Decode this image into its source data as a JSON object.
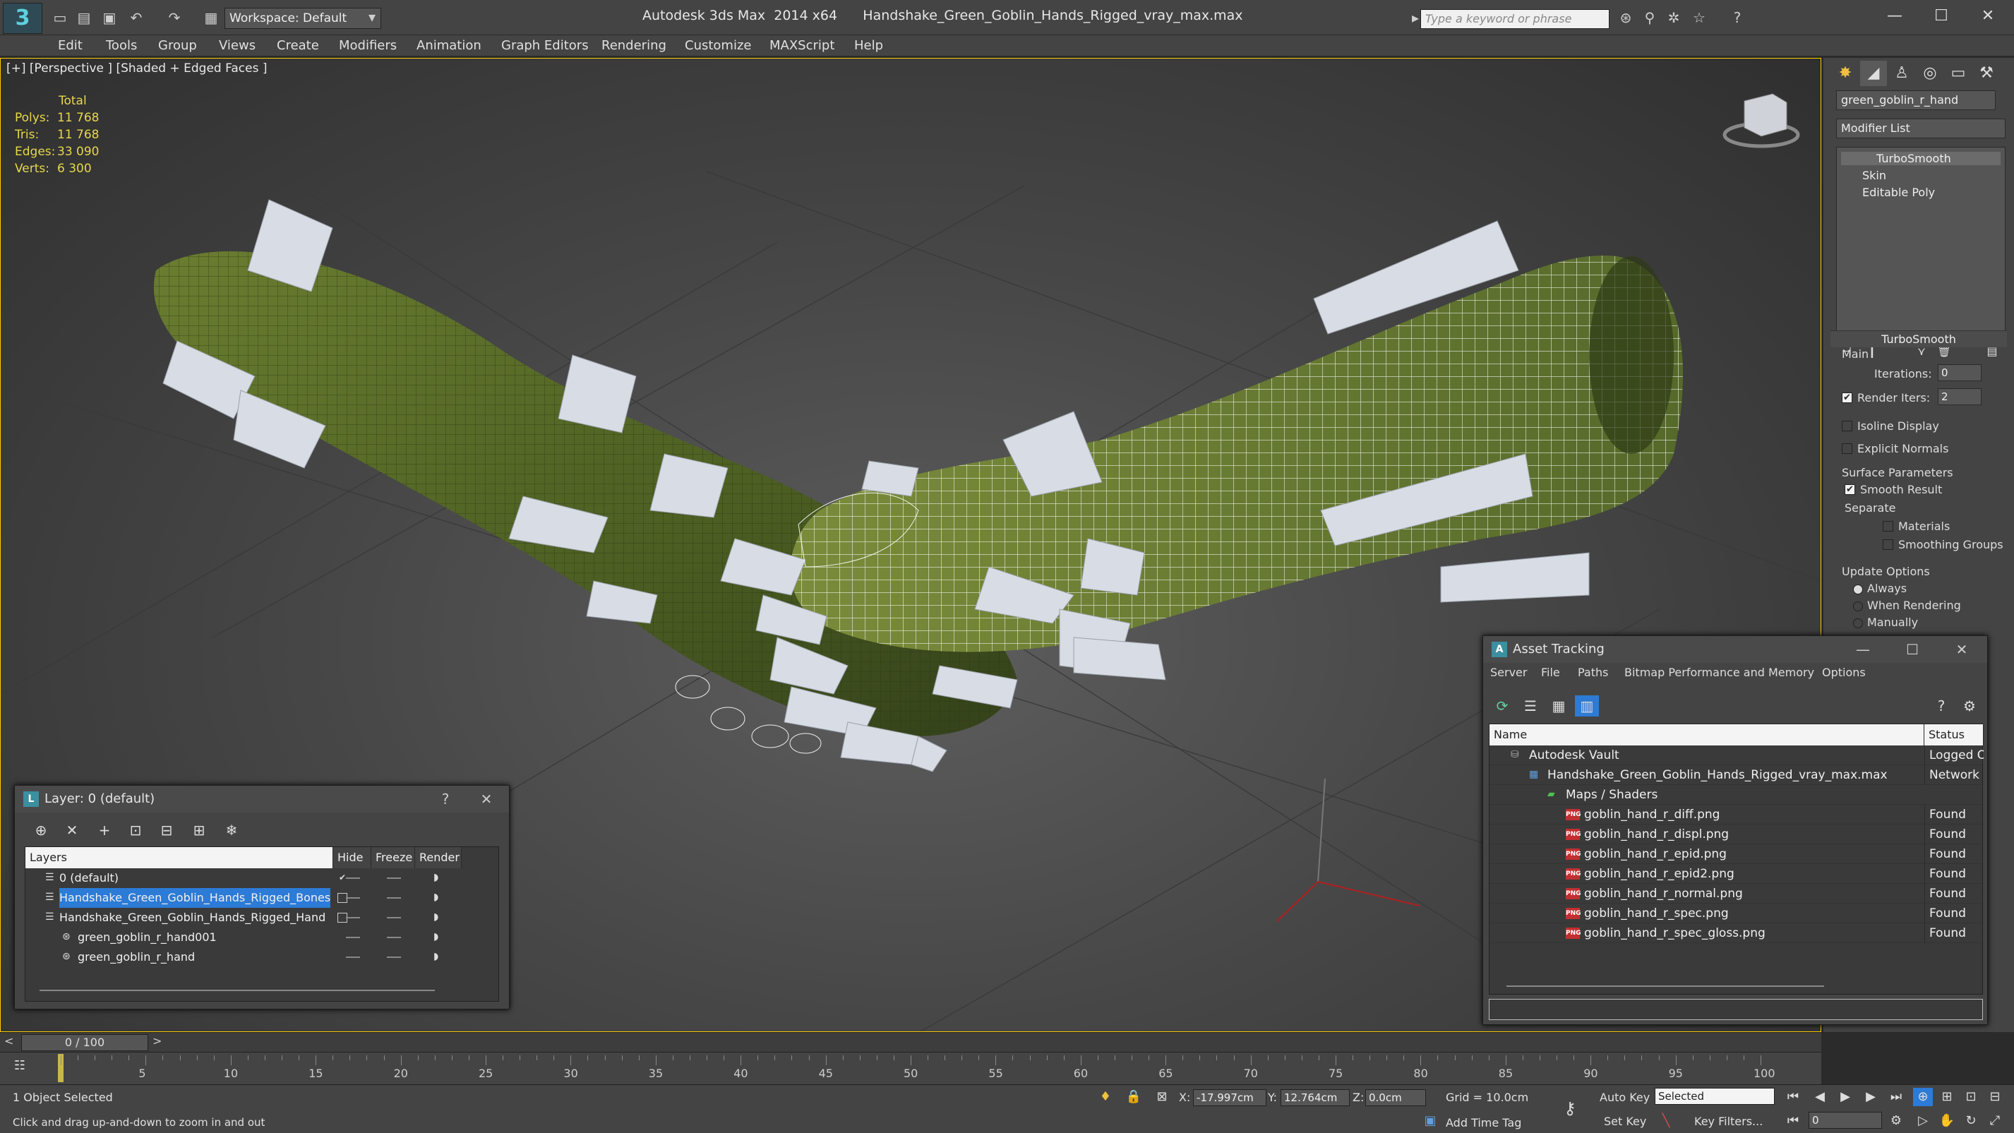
{
  "window": {
    "app_title": "Autodesk 3ds Max  2014 x64      Handshake_Green_Goblin_Hands_Rigged_vray_max.max",
    "workspace": "Workspace: Default",
    "search_placeholder": "Type a keyword or phrase"
  },
  "menu": [
    "Edit",
    "Tools",
    "Group",
    "Views",
    "Create",
    "Modifiers",
    "Animation",
    "Graph Editors",
    "Rendering",
    "Customize",
    "MAXScript",
    "Help"
  ],
  "viewport": {
    "label": "[+] [Perspective ] [Shaded + Edged Faces ]",
    "stats": {
      "header": "Total",
      "rows": [
        {
          "k": "Polys:",
          "v": "11 768"
        },
        {
          "k": "Tris:",
          "v": "11 768"
        },
        {
          "k": "Edges:",
          "v": "33 090"
        },
        {
          "k": "Verts:",
          "v": "6 300"
        }
      ]
    },
    "colors": {
      "skin": "#5a6e2a",
      "skin_dark": "#3e4e1c",
      "bones": "#d8dce4",
      "wire": "#ffffff"
    }
  },
  "command_panel": {
    "object_name": "green_goblin_r_hand",
    "modifier_list": "Modifier List",
    "stack": [
      "TurboSmooth",
      "Skin",
      "Editable Poly"
    ],
    "rollout": "TurboSmooth",
    "main_label": "Main",
    "iterations_label": "Iterations:",
    "iterations_value": "0",
    "render_iters_label": "Render Iters:",
    "render_iters_value": "2",
    "isoline_label": "Isoline Display",
    "explicit_label": "Explicit Normals",
    "surface_label": "Surface Parameters",
    "smooth_label": "Smooth Result",
    "separate_label": "Separate",
    "materials_label": "Materials",
    "smoothing_groups_label": "Smoothing Groups",
    "update_label": "Update Options",
    "always_label": "Always",
    "when_rendering_label": "When Rendering",
    "manually_label": "Manually"
  },
  "layer_window": {
    "title": "Layer: 0 (default)",
    "help": "?",
    "columns": {
      "layers": "Layers",
      "hide": "Hide",
      "freeze": "Freeze",
      "render": "Render"
    },
    "rows": [
      {
        "name": "0 (default)",
        "indent": 0,
        "selected": false,
        "checked": true
      },
      {
        "name": "Handshake_Green_Goblin_Hands_Rigged_Bones",
        "indent": 0,
        "selected": true,
        "checked": false
      },
      {
        "name": "Handshake_Green_Goblin_Hands_Rigged_Hand",
        "indent": 0,
        "selected": false,
        "checked": false
      },
      {
        "name": "green_goblin_r_hand001",
        "indent": 1,
        "selected": false,
        "checked": false
      },
      {
        "name": "green_goblin_r_hand",
        "indent": 1,
        "selected": false,
        "checked": false
      }
    ]
  },
  "asset_window": {
    "title": "Asset Tracking",
    "menu": [
      "Server",
      "File",
      "Paths",
      "Bitmap Performance and Memory",
      "Options"
    ],
    "columns": {
      "name": "Name",
      "status": "Status"
    },
    "rows": [
      {
        "name": "Autodesk Vault",
        "status": "Logged O",
        "indent": 0,
        "type": "vault"
      },
      {
        "name": "Handshake_Green_Goblin_Hands_Rigged_vray_max.max",
        "status": "Network P",
        "indent": 1,
        "type": "max"
      },
      {
        "name": "Maps / Shaders",
        "status": "",
        "indent": 2,
        "type": "folder"
      },
      {
        "name": "goblin_hand_r_diff.png",
        "status": "Found",
        "indent": 3,
        "type": "png"
      },
      {
        "name": "goblin_hand_r_displ.png",
        "status": "Found",
        "indent": 3,
        "type": "png"
      },
      {
        "name": "goblin_hand_r_epid.png",
        "status": "Found",
        "indent": 3,
        "type": "png"
      },
      {
        "name": "goblin_hand_r_epid2.png",
        "status": "Found",
        "indent": 3,
        "type": "png"
      },
      {
        "name": "goblin_hand_r_normal.png",
        "status": "Found",
        "indent": 3,
        "type": "png"
      },
      {
        "name": "goblin_hand_r_spec.png",
        "status": "Found",
        "indent": 3,
        "type": "png"
      },
      {
        "name": "goblin_hand_r_spec_gloss.png",
        "status": "Found",
        "indent": 3,
        "type": "png"
      }
    ],
    "png_badge": "PNG"
  },
  "timeline": {
    "slider": "0 / 100",
    "ticks": [
      "5",
      "10",
      "15",
      "20",
      "25",
      "30",
      "35",
      "40",
      "45",
      "50",
      "55",
      "60",
      "65",
      "70",
      "75",
      "80",
      "85",
      "90",
      "95",
      "100"
    ]
  },
  "status": {
    "selection": "1 Object Selected",
    "prompt": "Click and drag up-and-down to zoom in and out",
    "x_label": "X:",
    "x_value": "-17.997cm",
    "y_label": "Y:",
    "y_value": "12.764cm",
    "z_label": "Z:",
    "z_value": "0.0cm",
    "grid": "Grid = 10.0cm",
    "auto_key": "Auto Key",
    "set_key": "Set Key",
    "selected": "Selected",
    "key_filters": "Key Filters...",
    "add_time_tag": "Add Time Tag",
    "frame": "0"
  }
}
